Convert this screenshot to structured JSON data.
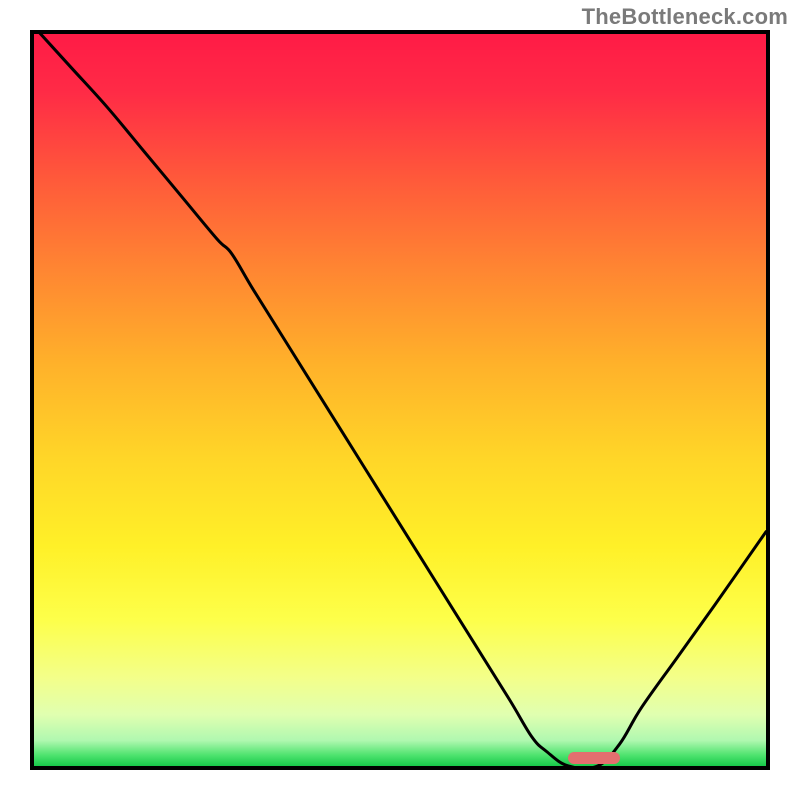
{
  "watermark": "TheBottleneck.com",
  "chart_data": {
    "type": "line",
    "title": "",
    "xlabel": "",
    "ylabel": "",
    "xlim": [
      0,
      100
    ],
    "ylim": [
      0,
      100
    ],
    "x": [
      0,
      5,
      10,
      15,
      20,
      25,
      27,
      30,
      35,
      40,
      45,
      50,
      55,
      60,
      65,
      68,
      70,
      73,
      77,
      80,
      83,
      88,
      93,
      100
    ],
    "values": [
      101,
      95.5,
      90,
      84,
      78,
      72,
      70,
      65,
      57,
      49,
      41,
      33,
      25,
      17,
      9,
      4,
      2,
      0,
      0,
      3,
      8,
      15,
      22,
      32
    ],
    "marker": {
      "x_start": 73,
      "x_end": 80,
      "y": 0.5
    },
    "gradient_stops": [
      {
        "pos": 0.0,
        "color": "#ff1b46"
      },
      {
        "pos": 0.08,
        "color": "#ff2b46"
      },
      {
        "pos": 0.2,
        "color": "#ff5a3a"
      },
      {
        "pos": 0.32,
        "color": "#ff8532"
      },
      {
        "pos": 0.45,
        "color": "#ffb12a"
      },
      {
        "pos": 0.58,
        "color": "#ffd628"
      },
      {
        "pos": 0.7,
        "color": "#fff028"
      },
      {
        "pos": 0.8,
        "color": "#fdff4a"
      },
      {
        "pos": 0.88,
        "color": "#f3ff8a"
      },
      {
        "pos": 0.93,
        "color": "#e0ffb0"
      },
      {
        "pos": 0.965,
        "color": "#b0f8b0"
      },
      {
        "pos": 0.985,
        "color": "#4fe36f"
      },
      {
        "pos": 1.0,
        "color": "#18c94a"
      }
    ]
  }
}
